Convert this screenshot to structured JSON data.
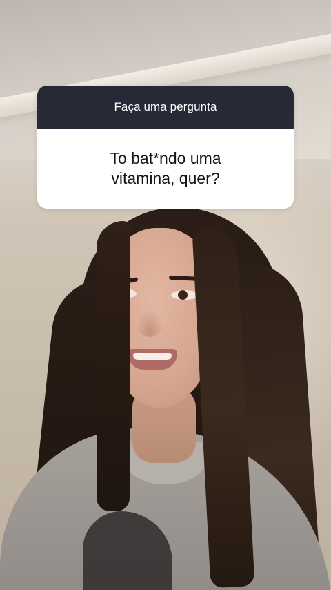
{
  "question_sticker": {
    "title": "Faça uma pergunta",
    "answer": "To bat*ndo uma\nvitamina, quer?"
  },
  "colors": {
    "header_bg": "#262a36",
    "header_text": "#ffffff",
    "body_bg": "#ffffff",
    "body_text": "#141414"
  }
}
